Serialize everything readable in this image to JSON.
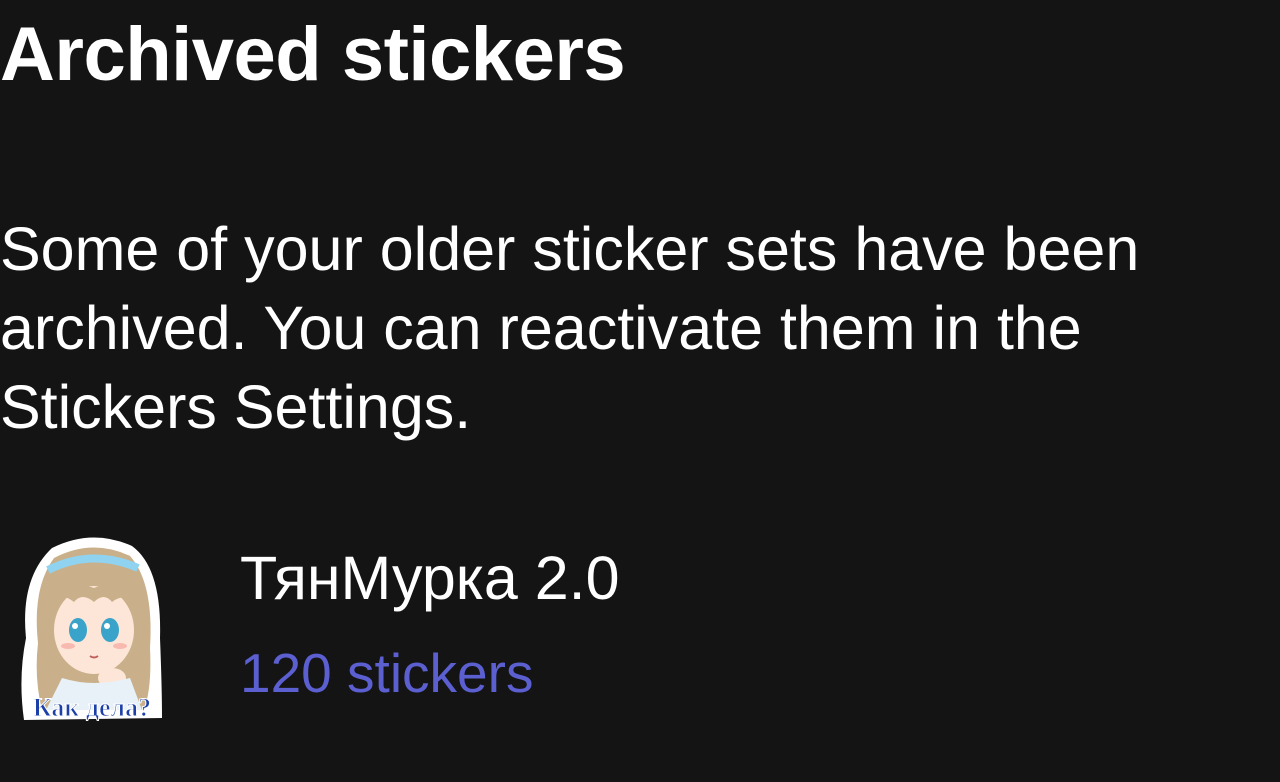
{
  "dialog": {
    "title": "Archived stickers",
    "message": "Some of your older sticker sets have been archived. You can reactivate them in the Stickers Settings."
  },
  "sticker_sets": [
    {
      "name": "ТянМурка 2.0",
      "count_label": "120 stickers",
      "thumbnail_caption": "Как дела?"
    }
  ],
  "colors": {
    "background": "#141414",
    "text_primary": "#ffffff",
    "accent": "#5b5fd0"
  }
}
